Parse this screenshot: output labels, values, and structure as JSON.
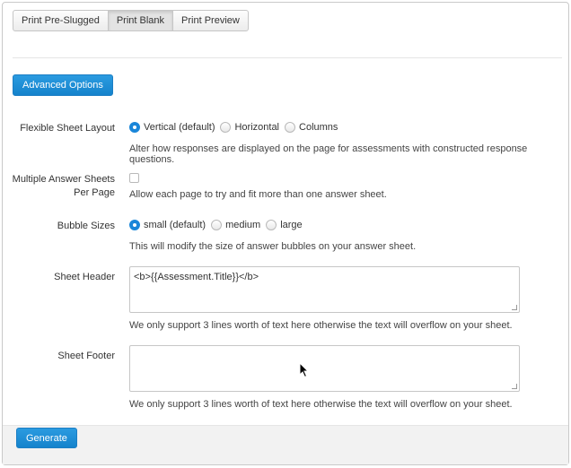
{
  "tabs": [
    "Print Pre-Slugged",
    "Print Blank",
    "Print Preview"
  ],
  "advanced_button": "Advanced Options",
  "flexible_layout": {
    "label": "Flexible Sheet Layout",
    "options": [
      "Vertical (default)",
      "Horizontal",
      "Columns"
    ],
    "help": "Alter how responses are displayed on the page for assessments with constructed response questions."
  },
  "multiple_sheets": {
    "label_line1": "Multiple Answer Sheets",
    "label_line2": "Per Page",
    "help": "Allow each page to try and fit more than one answer sheet."
  },
  "bubble_sizes": {
    "label": "Bubble Sizes",
    "options": [
      "small (default)",
      "medium",
      "large"
    ],
    "help": "This will modify the size of answer bubbles on your answer sheet."
  },
  "sheet_header": {
    "label": "Sheet Header",
    "value": "<b>{{Assessment.Title}}</b>",
    "help": "We only support 3 lines worth of text here otherwise the text will overflow on your sheet."
  },
  "sheet_footer": {
    "label": "Sheet Footer",
    "value": "",
    "help": "We only support 3 lines worth of text here otherwise the text will overflow on your sheet."
  },
  "generate_button": "Generate"
}
